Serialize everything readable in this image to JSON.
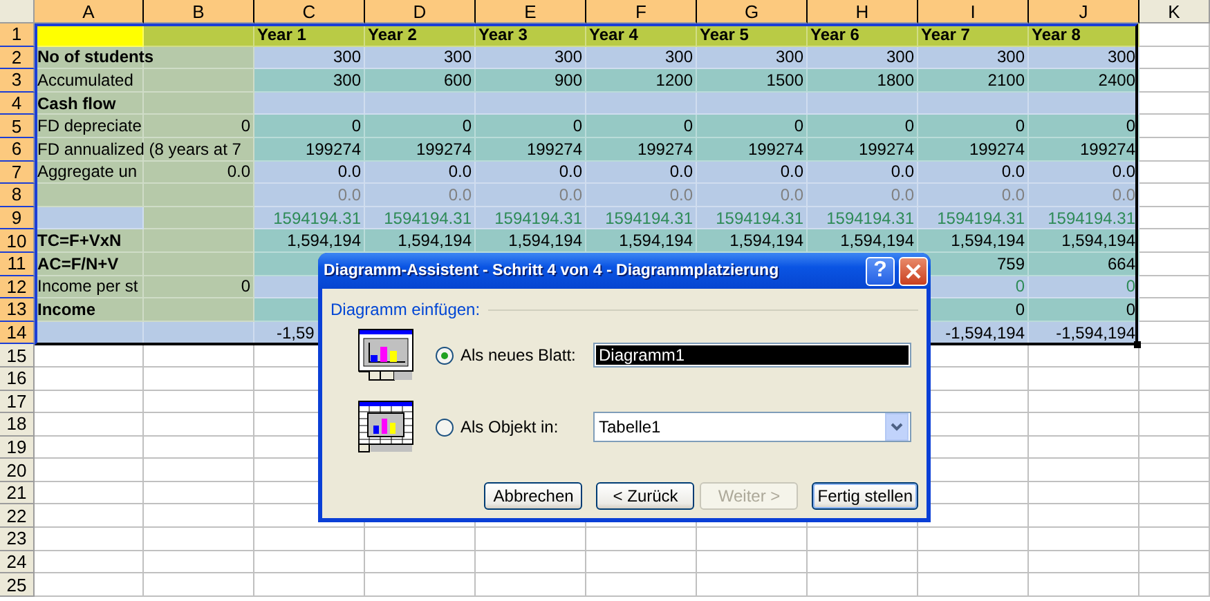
{
  "columns": [
    {
      "label": "A",
      "selected": true
    },
    {
      "label": "B",
      "selected": true
    },
    {
      "label": "C",
      "selected": true
    },
    {
      "label": "D",
      "selected": true
    },
    {
      "label": "E",
      "selected": true
    },
    {
      "label": "F",
      "selected": true
    },
    {
      "label": "G",
      "selected": true
    },
    {
      "label": "H",
      "selected": true
    },
    {
      "label": "I",
      "selected": true
    },
    {
      "label": "J",
      "selected": true
    },
    {
      "label": "K",
      "selected": false
    }
  ],
  "rows": [
    {
      "header": "1",
      "selected": true,
      "cells": [
        {
          "color": "#ffff00"
        },
        {
          "color": "#b9cb45"
        },
        {
          "color": "#b9cb45",
          "kind": "title",
          "text": "Year 1"
        },
        {
          "color": "#b9cb45",
          "kind": "title",
          "text": "Year 2"
        },
        {
          "color": "#b9cb45",
          "kind": "title",
          "text": "Year 3"
        },
        {
          "color": "#b9cb45",
          "kind": "title",
          "text": "Year 4"
        },
        {
          "color": "#b9cb45",
          "kind": "title",
          "text": "Year 5"
        },
        {
          "color": "#b9cb45",
          "kind": "title",
          "text": "Year 6"
        },
        {
          "color": "#b9cb45",
          "kind": "title",
          "text": "Year 7"
        },
        {
          "color": "#b9cb45",
          "kind": "title",
          "text": "Year 8"
        },
        {}
      ]
    },
    {
      "header": "2",
      "selected": true,
      "cells": [
        {
          "color": "#b6c9a9",
          "kind": "title",
          "text": "No of students"
        },
        {
          "color": "#b6c9a9"
        },
        {
          "color": "#b7cbe6",
          "kind": "number",
          "text": "300"
        },
        {
          "color": "#b7cbe6",
          "kind": "number",
          "text": "300"
        },
        {
          "color": "#b7cbe6",
          "kind": "number",
          "text": "300"
        },
        {
          "color": "#b7cbe6",
          "kind": "number",
          "text": "300"
        },
        {
          "color": "#b7cbe6",
          "kind": "number",
          "text": "300"
        },
        {
          "color": "#b7cbe6",
          "kind": "number",
          "text": "300"
        },
        {
          "color": "#b7cbe6",
          "kind": "number",
          "text": "300"
        },
        {
          "color": "#b7cbe6",
          "kind": "number",
          "text": "300"
        },
        {}
      ]
    },
    {
      "header": "3",
      "selected": true,
      "cells": [
        {
          "color": "#b6c9a9",
          "kind": "text",
          "text": "Accumulated"
        },
        {
          "color": "#b6c9a9"
        },
        {
          "color": "#96c9c5",
          "kind": "number",
          "text": "300"
        },
        {
          "color": "#96c9c5",
          "kind": "number",
          "text": "600"
        },
        {
          "color": "#96c9c5",
          "kind": "number",
          "text": "900"
        },
        {
          "color": "#96c9c5",
          "kind": "number",
          "text": "1200"
        },
        {
          "color": "#96c9c5",
          "kind": "number",
          "text": "1500"
        },
        {
          "color": "#96c9c5",
          "kind": "number",
          "text": "1800"
        },
        {
          "color": "#96c9c5",
          "kind": "number",
          "text": "2100"
        },
        {
          "color": "#96c9c5",
          "kind": "number",
          "text": "2400"
        },
        {}
      ]
    },
    {
      "header": "4",
      "selected": true,
      "cells": [
        {
          "color": "#b6c9a9",
          "kind": "title",
          "text": "Cash flow"
        },
        {
          "color": "#b6c9a9"
        },
        {
          "color": "#b7cbe6"
        },
        {
          "color": "#b7cbe6"
        },
        {
          "color": "#b7cbe6"
        },
        {
          "color": "#b7cbe6"
        },
        {
          "color": "#b7cbe6"
        },
        {
          "color": "#b7cbe6"
        },
        {
          "color": "#b7cbe6"
        },
        {
          "color": "#b7cbe6"
        },
        {}
      ]
    },
    {
      "header": "5",
      "selected": true,
      "cells": [
        {
          "color": "#b6c9a9",
          "kind": "text",
          "text": "FD depreciate"
        },
        {
          "color": "#b6c9a9",
          "kind": "number",
          "text": "0"
        },
        {
          "color": "#96c9c5",
          "kind": "number",
          "text": "0"
        },
        {
          "color": "#96c9c5",
          "kind": "number",
          "text": "0"
        },
        {
          "color": "#96c9c5",
          "kind": "number",
          "text": "0"
        },
        {
          "color": "#96c9c5",
          "kind": "number",
          "text": "0"
        },
        {
          "color": "#96c9c5",
          "kind": "number",
          "text": "0"
        },
        {
          "color": "#96c9c5",
          "kind": "number",
          "text": "0"
        },
        {
          "color": "#96c9c5",
          "kind": "number",
          "text": "0"
        },
        {
          "color": "#96c9c5",
          "kind": "number",
          "text": "0"
        },
        {}
      ]
    },
    {
      "header": "6",
      "selected": true,
      "cells": [
        {
          "color": "#b6c9a9",
          "kind": "text",
          "text": "FD annualized (8 years at 7"
        },
        {
          "color": "#b6c9a9"
        },
        {
          "color": "#96c9c5",
          "kind": "number",
          "text": "199274"
        },
        {
          "color": "#96c9c5",
          "kind": "number",
          "text": "199274"
        },
        {
          "color": "#96c9c5",
          "kind": "number",
          "text": "199274"
        },
        {
          "color": "#96c9c5",
          "kind": "number",
          "text": "199274"
        },
        {
          "color": "#96c9c5",
          "kind": "number",
          "text": "199274"
        },
        {
          "color": "#96c9c5",
          "kind": "number",
          "text": "199274"
        },
        {
          "color": "#96c9c5",
          "kind": "number",
          "text": "199274"
        },
        {
          "color": "#96c9c5",
          "kind": "number",
          "text": "199274"
        },
        {}
      ]
    },
    {
      "header": "7",
      "selected": true,
      "cells": [
        {
          "color": "#b6c9a9",
          "kind": "text",
          "text": "Aggregate un"
        },
        {
          "color": "#b6c9a9",
          "kind": "number",
          "text": "0.0"
        },
        {
          "color": "#b7cbe6",
          "kind": "number",
          "text": "0.0"
        },
        {
          "color": "#b7cbe6",
          "kind": "number",
          "text": "0.0"
        },
        {
          "color": "#b7cbe6",
          "kind": "number",
          "text": "0.0"
        },
        {
          "color": "#b7cbe6",
          "kind": "number",
          "text": "0.0"
        },
        {
          "color": "#b7cbe6",
          "kind": "number",
          "text": "0.0"
        },
        {
          "color": "#b7cbe6",
          "kind": "number",
          "text": "0.0"
        },
        {
          "color": "#b7cbe6",
          "kind": "number",
          "text": "0.0"
        },
        {
          "color": "#b7cbe6",
          "kind": "number",
          "text": "0.0"
        },
        {}
      ]
    },
    {
      "header": "8",
      "selected": true,
      "cells": [
        {
          "color": "#b6c9a9"
        },
        {
          "color": "#b6c9a9"
        },
        {
          "color": "#b7cbe6",
          "kind": "faded",
          "text": "0.0"
        },
        {
          "color": "#b7cbe6",
          "kind": "faded",
          "text": "0.0"
        },
        {
          "color": "#b7cbe6",
          "kind": "faded",
          "text": "0.0"
        },
        {
          "color": "#b7cbe6",
          "kind": "faded",
          "text": "0.0"
        },
        {
          "color": "#b7cbe6",
          "kind": "faded",
          "text": "0.0"
        },
        {
          "color": "#b7cbe6",
          "kind": "faded",
          "text": "0.0"
        },
        {
          "color": "#b7cbe6",
          "kind": "faded",
          "text": "0.0"
        },
        {
          "color": "#b7cbe6",
          "kind": "faded",
          "text": "0.0"
        },
        {}
      ]
    },
    {
      "header": "9",
      "selected": true,
      "cells": [
        {
          "color": "#b7cbe6"
        },
        {
          "color": "#b6c9a9"
        },
        {
          "color": "#b7cbe6",
          "kind": "formula",
          "text": "1594194.31"
        },
        {
          "color": "#b7cbe6",
          "kind": "formula",
          "text": "1594194.31"
        },
        {
          "color": "#b7cbe6",
          "kind": "formula",
          "text": "1594194.31"
        },
        {
          "color": "#b7cbe6",
          "kind": "formula",
          "text": "1594194.31"
        },
        {
          "color": "#b7cbe6",
          "kind": "formula",
          "text": "1594194.31"
        },
        {
          "color": "#b7cbe6",
          "kind": "formula",
          "text": "1594194.31"
        },
        {
          "color": "#b7cbe6",
          "kind": "formula",
          "text": "1594194.31"
        },
        {
          "color": "#b7cbe6",
          "kind": "formula",
          "text": "1594194.31"
        },
        {}
      ]
    },
    {
      "header": "10",
      "selected": true,
      "cells": [
        {
          "color": "#b6c9a9",
          "kind": "title",
          "text": "TC=F+VxN"
        },
        {
          "color": "#b6c9a9"
        },
        {
          "color": "#96c9c5",
          "kind": "number",
          "text": "1,594,194"
        },
        {
          "color": "#96c9c5",
          "kind": "number",
          "text": "1,594,194"
        },
        {
          "color": "#96c9c5",
          "kind": "number",
          "text": "1,594,194"
        },
        {
          "color": "#96c9c5",
          "kind": "number",
          "text": "1,594,194"
        },
        {
          "color": "#96c9c5",
          "kind": "number",
          "text": "1,594,194"
        },
        {
          "color": "#96c9c5",
          "kind": "number",
          "text": "1,594,194"
        },
        {
          "color": "#96c9c5",
          "kind": "number",
          "text": "1,594,194"
        },
        {
          "color": "#96c9c5",
          "kind": "number",
          "text": "1,594,194"
        },
        {}
      ]
    },
    {
      "header": "11",
      "selected": true,
      "cells": [
        {
          "color": "#b6c9a9",
          "kind": "title",
          "text": "AC=F/N+V"
        },
        {
          "color": "#b6c9a9"
        },
        {
          "color": "#96c9c5"
        },
        {},
        {},
        {},
        {},
        {},
        {
          "color": "#96c9c5",
          "kind": "number",
          "text": "759"
        },
        {
          "color": "#96c9c5",
          "kind": "number",
          "text": "664"
        },
        {}
      ]
    },
    {
      "header": "12",
      "selected": true,
      "cells": [
        {
          "color": "#b6c9a9",
          "kind": "text",
          "text": "Income per st"
        },
        {
          "color": "#b6c9a9",
          "kind": "number",
          "text": "0"
        },
        {
          "color": "#b7cbe6"
        },
        {},
        {},
        {},
        {},
        {},
        {
          "color": "#b7cbe6",
          "kind": "formula",
          "text": "0"
        },
        {
          "color": "#b7cbe6",
          "kind": "formula",
          "text": "0"
        },
        {}
      ]
    },
    {
      "header": "13",
      "selected": true,
      "cells": [
        {
          "color": "#b6c9a9",
          "kind": "title",
          "text": "Income"
        },
        {
          "color": "#b6c9a9"
        },
        {
          "color": "#96c9c5"
        },
        {},
        {},
        {},
        {},
        {},
        {
          "color": "#96c9c5",
          "kind": "number",
          "text": "0"
        },
        {
          "color": "#96c9c5",
          "kind": "number",
          "text": "0"
        },
        {}
      ]
    },
    {
      "header": "14",
      "selected": true,
      "cells": [
        {
          "color": "#b7cbe6"
        },
        {
          "color": "#b7cbe6"
        },
        {
          "color": "#b7cbe6",
          "kind": "clipped",
          "text": "-1,59"
        },
        {},
        {},
        {},
        {},
        {},
        {
          "color": "#b7cbe6",
          "kind": "number",
          "text": "-1,594,194"
        },
        {
          "color": "#b7cbe6",
          "kind": "number",
          "text": "-1,594,194"
        },
        {}
      ]
    },
    {
      "header": "15",
      "selected": false
    },
    {
      "header": "16",
      "selected": false
    },
    {
      "header": "17",
      "selected": false
    },
    {
      "header": "18",
      "selected": false
    },
    {
      "header": "19",
      "selected": false
    },
    {
      "header": "20",
      "selected": false
    },
    {
      "header": "21",
      "selected": false
    },
    {
      "header": "22",
      "selected": false
    },
    {
      "header": "23",
      "selected": false
    },
    {
      "header": "24",
      "selected": false
    },
    {
      "header": "25",
      "selected": false
    }
  ],
  "dialog": {
    "title": "Diagramm-Assistent - Schritt 4 von 4 - Diagrammplatzierung",
    "help_button": "?",
    "group_label": "Diagramm einfügen:",
    "options": [
      {
        "kind": "sheet",
        "label": "Als neues Blatt:",
        "selected": true,
        "field": {
          "kind": "text",
          "value": "Diagramm1",
          "highlighted": true
        }
      },
      {
        "kind": "object",
        "label": "Als Objekt in:",
        "selected": false,
        "field": {
          "kind": "dropdown",
          "value": "Tabelle1",
          "highlighted": false
        }
      }
    ],
    "buttons": [
      {
        "label": "Abbrechen",
        "disabled": false,
        "default": false
      },
      {
        "label": "< Zurück",
        "disabled": false,
        "default": false
      },
      {
        "label": "Weiter >",
        "disabled": true,
        "default": false
      },
      {
        "label": "Fertig stellen",
        "disabled": false,
        "default": true
      }
    ]
  }
}
